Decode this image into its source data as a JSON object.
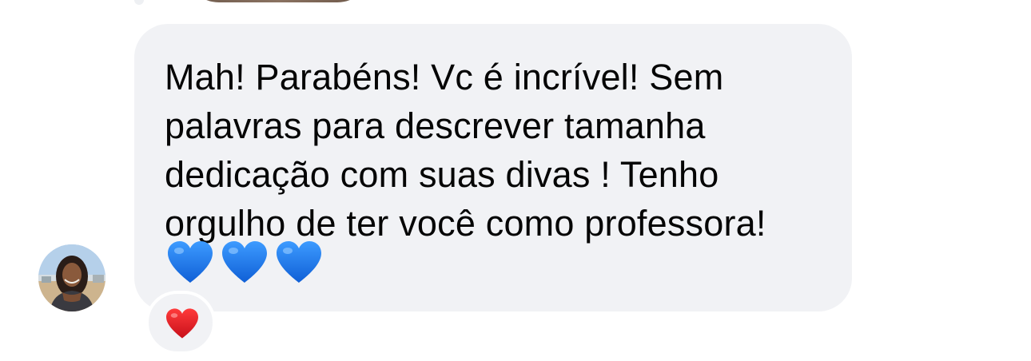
{
  "comment": {
    "text": "Mah! Parabéns! Vc é incrível! Sem palavras para descrever tamanha dedicação com suas divas ! Tenho orgulho de ter você como professora!",
    "emoji": [
      "blue-heart",
      "blue-heart",
      "blue-heart"
    ],
    "colors": {
      "bubble_background": "#f1f2f5",
      "text": "#050505",
      "blue_heart": "#1d7bf2",
      "red_heart": "#e0141e"
    }
  },
  "reaction": {
    "icon": "red-heart-icon"
  }
}
